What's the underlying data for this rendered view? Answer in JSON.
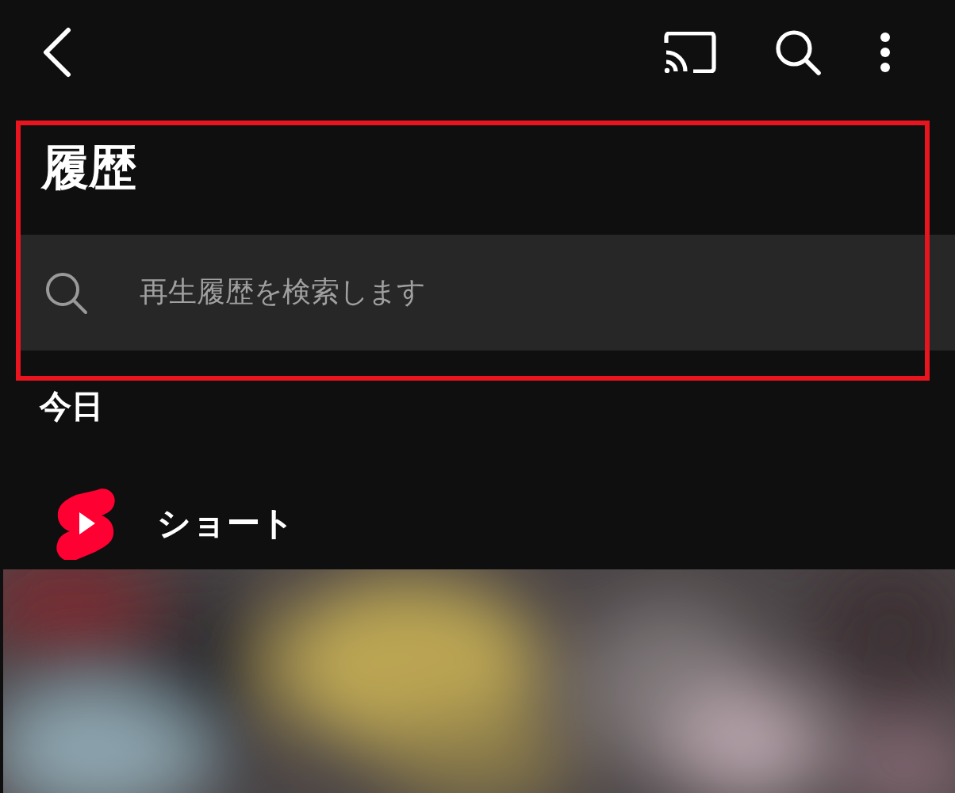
{
  "page": {
    "title": "履歴"
  },
  "search": {
    "placeholder": "再生履歴を検索します"
  },
  "highlight": {
    "kind": "frame",
    "color": "#e8141e"
  },
  "sections": [
    {
      "heading": "今日",
      "groups": [
        {
          "kind": "shorts",
          "label": "ショート"
        }
      ]
    }
  ]
}
